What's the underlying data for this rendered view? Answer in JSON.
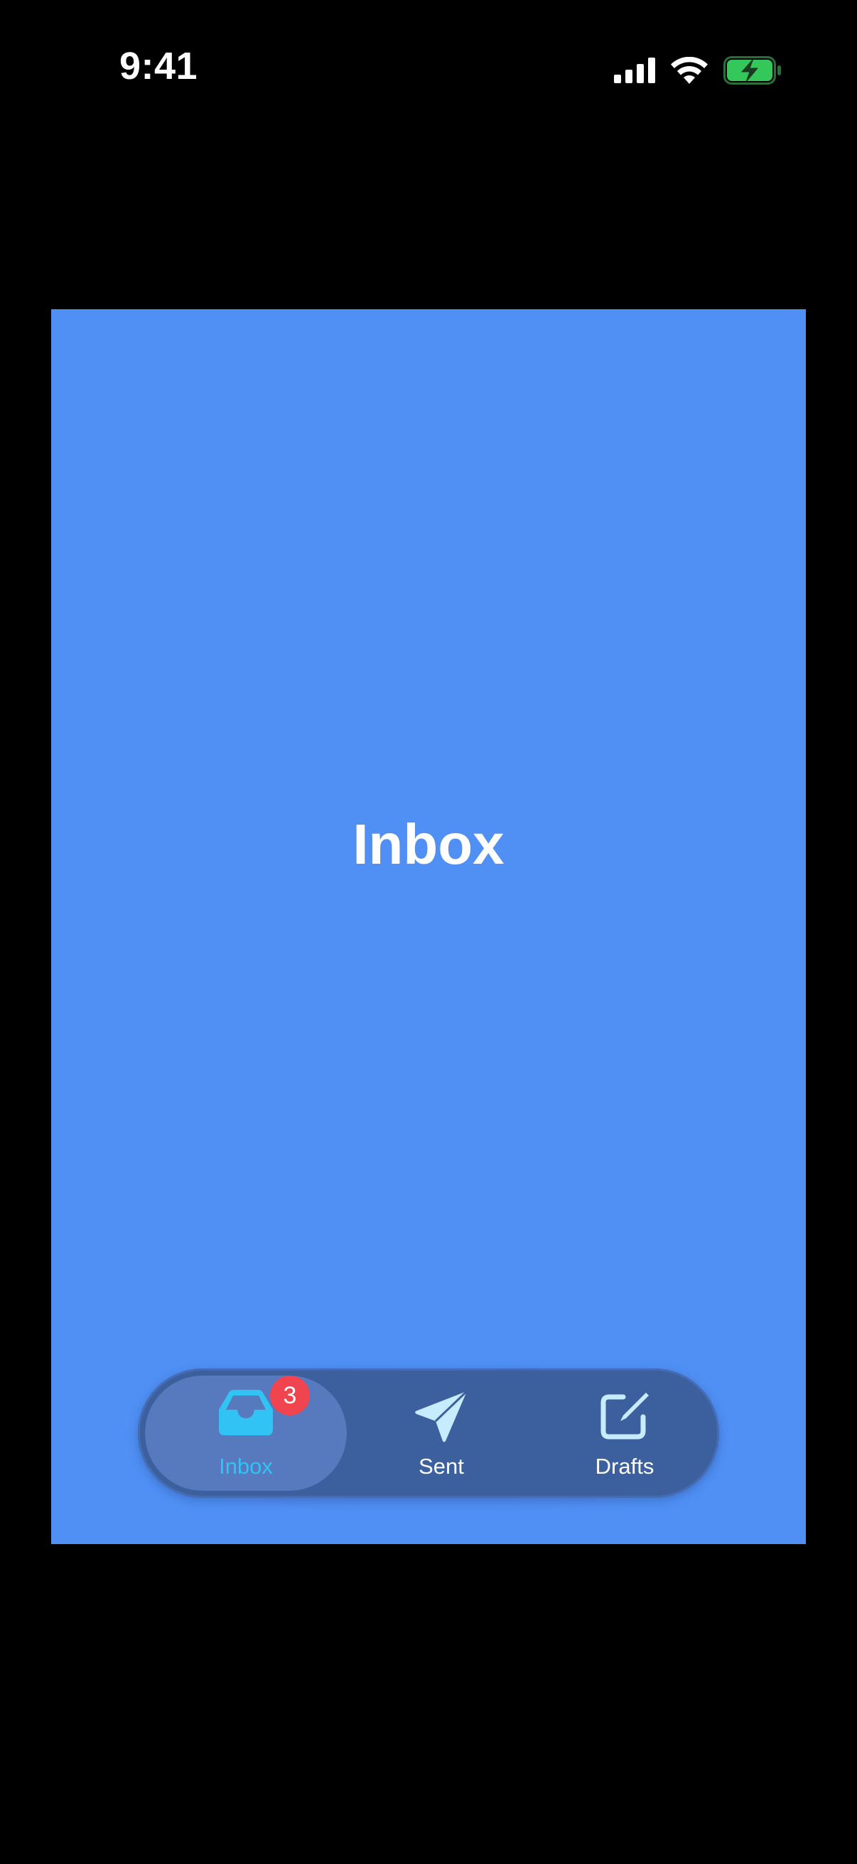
{
  "status_bar": {
    "time": "9:41",
    "icons": [
      "signal-icon",
      "wifi-icon",
      "battery-charging-icon"
    ],
    "battery_color": "#34c759"
  },
  "page": {
    "title": "Inbox",
    "background_color": "#5090f5"
  },
  "tab_bar": {
    "background_color": "#3c5f9e",
    "active_color": "#32c3f5",
    "tabs": [
      {
        "label": "Inbox",
        "icon": "inbox-tray-icon",
        "selected": true,
        "badge": "3"
      },
      {
        "label": "Sent",
        "icon": "paper-plane-icon",
        "selected": false
      },
      {
        "label": "Drafts",
        "icon": "compose-icon",
        "selected": false
      }
    ]
  }
}
